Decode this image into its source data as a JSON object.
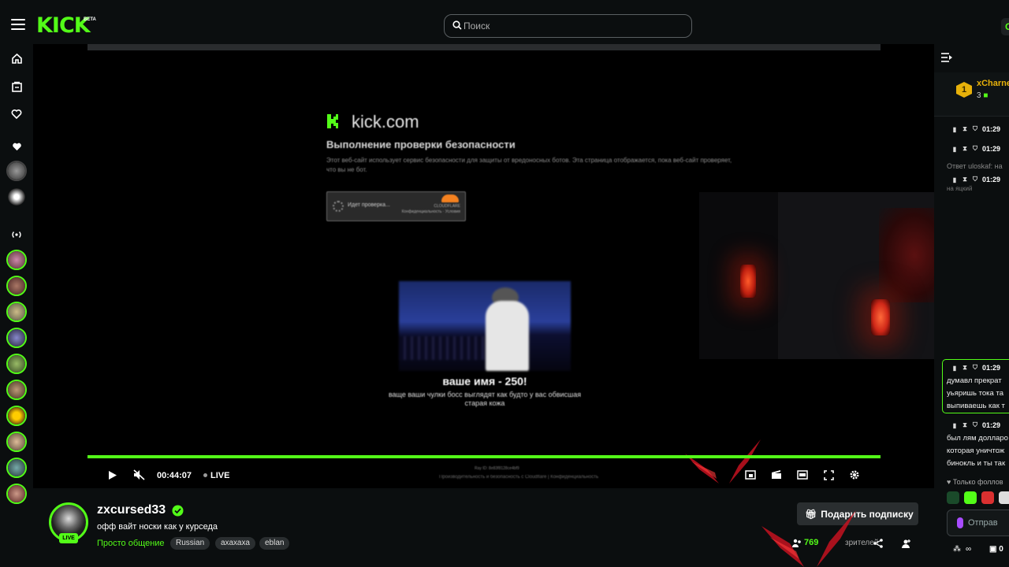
{
  "header": {
    "logo": "KICK",
    "logo_badge": "BETA",
    "search_placeholder": "Поиск",
    "top_right_letter": "C"
  },
  "player": {
    "overlay": {
      "domain": "kick.com",
      "title": "Выполнение проверки безопасности",
      "description": "Этот веб-сайт использует сервис безопасности для защиты от вредоносных ботов. Эта страница отображается, пока веб-сайт проверяет, что вы не бот.",
      "checkbox_label": "Идет проверка...",
      "provider_brand": "CLOUDFLARE",
      "provider_links": "Конфиденциальность · Условия",
      "ray_id": "Ray ID: 8e83f8128ce4bf9",
      "footer": "Производительность и безопасность с Cloudflare  |  Конфиденциальность"
    },
    "alert": {
      "name": "ваше имя - 250!",
      "message": "ваще ваши чулки босс выглядят как будто у вас обвисшая старая кожа"
    },
    "time": "00:44:07",
    "live_label": "LIVE",
    "progress": 1.0
  },
  "chat": {
    "pinned": {
      "rank": "1",
      "name": "xCharne",
      "count": "3"
    },
    "messages": [
      {
        "time": "01:29"
      },
      {
        "time": "01:29"
      },
      {
        "time": "01:29"
      },
      {
        "time": "01:29"
      },
      {
        "time": "01:29"
      }
    ],
    "reply_label": "Ответ uloskaf: на",
    "reply_snippet": "на яцкий",
    "highlight_lines": [
      "думавл прекрат",
      "уьяришь тока та",
      "выпиваешь как т"
    ],
    "last_lines": [
      "был лям долларо",
      "которая уничтож",
      "бинокль и ты так"
    ],
    "only_followers": "Только фоллов",
    "input_placeholder": "Отправ",
    "bottom_count": "0"
  },
  "info": {
    "streamer": "zxcursed33",
    "live_badge": "LIVE",
    "title": "офф вайт носки как у курседа",
    "category": "Просто общение",
    "tags": [
      "Russian",
      "ахахаха",
      "eblan"
    ],
    "subscribe_label": "Подарить подписку",
    "viewers": "769",
    "viewers_label": "зрителей"
  },
  "colors": {
    "accent": "#53fc18",
    "background": "#0b0e0f",
    "gold": "#e7b10a"
  }
}
